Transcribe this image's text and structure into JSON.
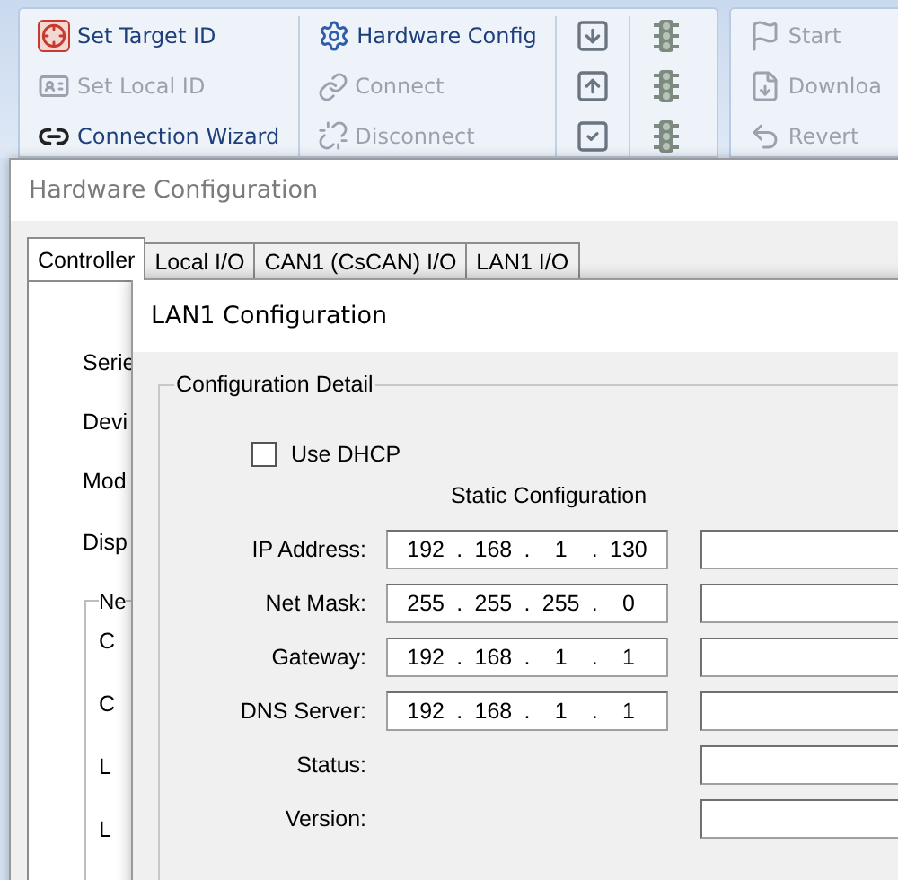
{
  "ribbon": {
    "groups": [
      {
        "columns": [
          {
            "items": [
              {
                "label": "Set Target ID",
                "disabled": false
              },
              {
                "label": "Set Local ID",
                "disabled": true
              },
              {
                "label": "Connection Wizard",
                "disabled": false
              }
            ]
          },
          {
            "items": [
              {
                "label": "Hardware Config",
                "disabled": false
              },
              {
                "label": "Connect",
                "disabled": true
              },
              {
                "label": "Disconnect",
                "disabled": true
              }
            ]
          }
        ]
      },
      {
        "columns": [
          {
            "items": [
              {
                "label": "Start",
                "disabled": true
              },
              {
                "label": "Downloa",
                "disabled": true
              },
              {
                "label": "Revert",
                "disabled": true
              }
            ]
          }
        ]
      }
    ]
  },
  "hardware_window": {
    "title": "Hardware Configuration",
    "tabs": [
      {
        "label": "Controller",
        "selected": true
      },
      {
        "label": "Local I/O",
        "selected": false
      },
      {
        "label": "CAN1 (CsCAN) I/O",
        "selected": false
      },
      {
        "label": "LAN1 I/O",
        "selected": false
      }
    ],
    "labels": [
      "Serie",
      "Devi",
      "Mod",
      "Disp"
    ],
    "group": {
      "legend": "Ne",
      "items": [
        "C",
        "C",
        "L",
        "L"
      ]
    }
  },
  "lan_dialog": {
    "title": "LAN1 Configuration",
    "group_title": "Configuration Detail",
    "use_dhcp": {
      "label": "Use DHCP",
      "checked": false
    },
    "static_heading": "Static Configuration",
    "separator": ".",
    "rows": [
      {
        "label": "IP Address:",
        "octets": [
          "192",
          "168",
          "1",
          "130"
        ]
      },
      {
        "label": "Net Mask:",
        "octets": [
          "255",
          "255",
          "255",
          "0"
        ]
      },
      {
        "label": "Gateway:",
        "octets": [
          "192",
          "168",
          "1",
          "1"
        ]
      },
      {
        "label": "DNS Server:",
        "octets": [
          "192",
          "168",
          "1",
          "1"
        ]
      },
      {
        "label": "Status:"
      },
      {
        "label": "Version:"
      }
    ]
  }
}
